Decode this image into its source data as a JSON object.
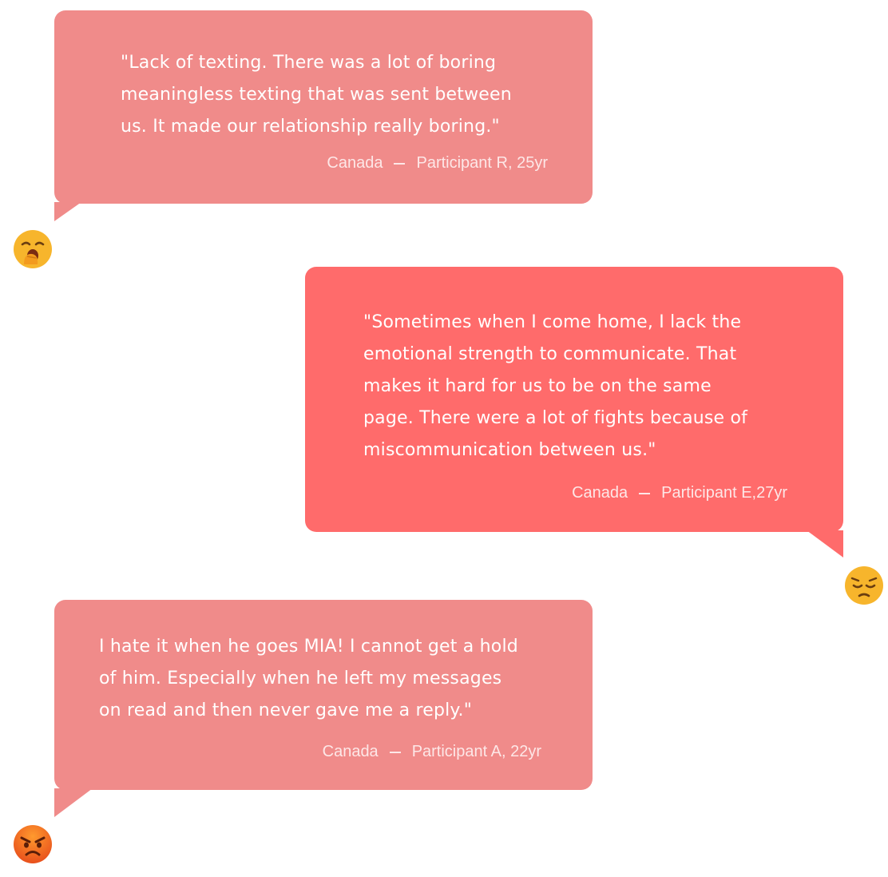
{
  "testimonials": [
    {
      "quote": "\"Lack of texting. There was a lot of boring\nmeaningless texting that was sent between\nus. It made our relationship really boring.\"",
      "location": "Canada",
      "participant": "Participant R, 25yr",
      "emoji": "yawning-face-icon"
    },
    {
      "quote": "\"Sometimes when I come home, I lack the\nemotional strength to communicate. That\nmakes it hard for us to be on the same\npage. There were a lot of fights because of\nmiscommunication between us.\"",
      "location": "Canada",
      "participant": "Participant E,27yr",
      "emoji": "pensive-face-icon"
    },
    {
      "quote": "I hate it when he goes MIA! I cannot get a hold\nof him. Especially when he left my messages\non read and then never gave me a reply.\"",
      "location": "Canada",
      "participant": "Participant A, 22yr",
      "emoji": "angry-face-icon"
    }
  ],
  "colors": {
    "bubble_soft": "#f08b8a",
    "bubble_strong": "#ff6b6b",
    "text": "#ffffff"
  }
}
